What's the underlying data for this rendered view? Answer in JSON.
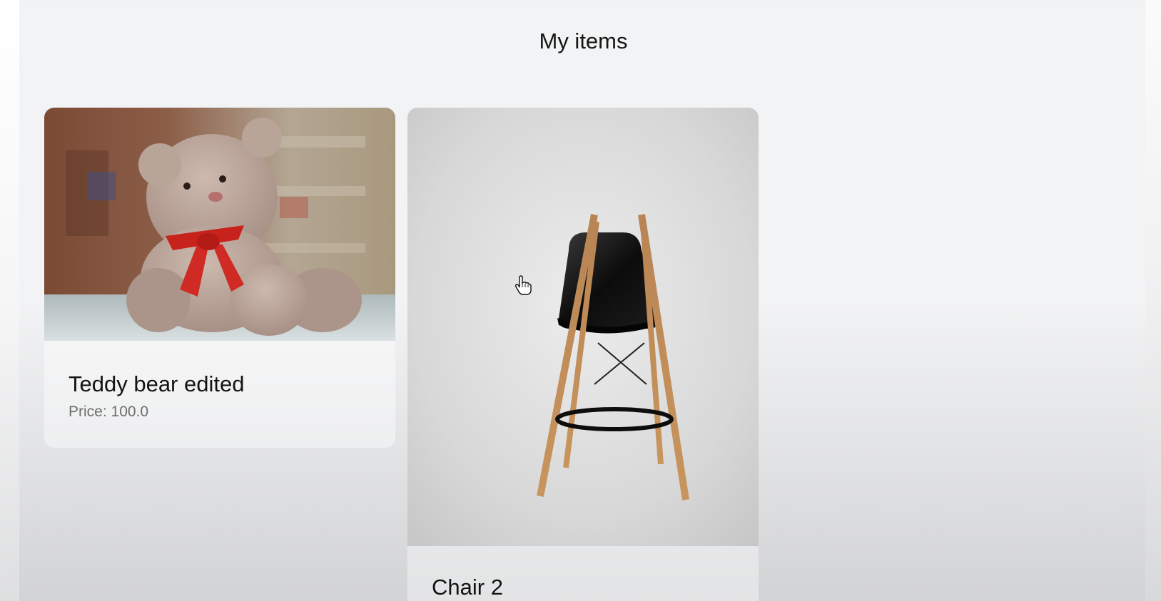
{
  "page": {
    "title": "My items"
  },
  "items": [
    {
      "title": "Teddy bear edited",
      "price": "Price: 100.0",
      "image_icon": "teddy-bear-photo"
    },
    {
      "title": "Chair 2",
      "image_icon": "chair-photo"
    }
  ],
  "cursor": {
    "icon": "hand-pointer-icon"
  }
}
